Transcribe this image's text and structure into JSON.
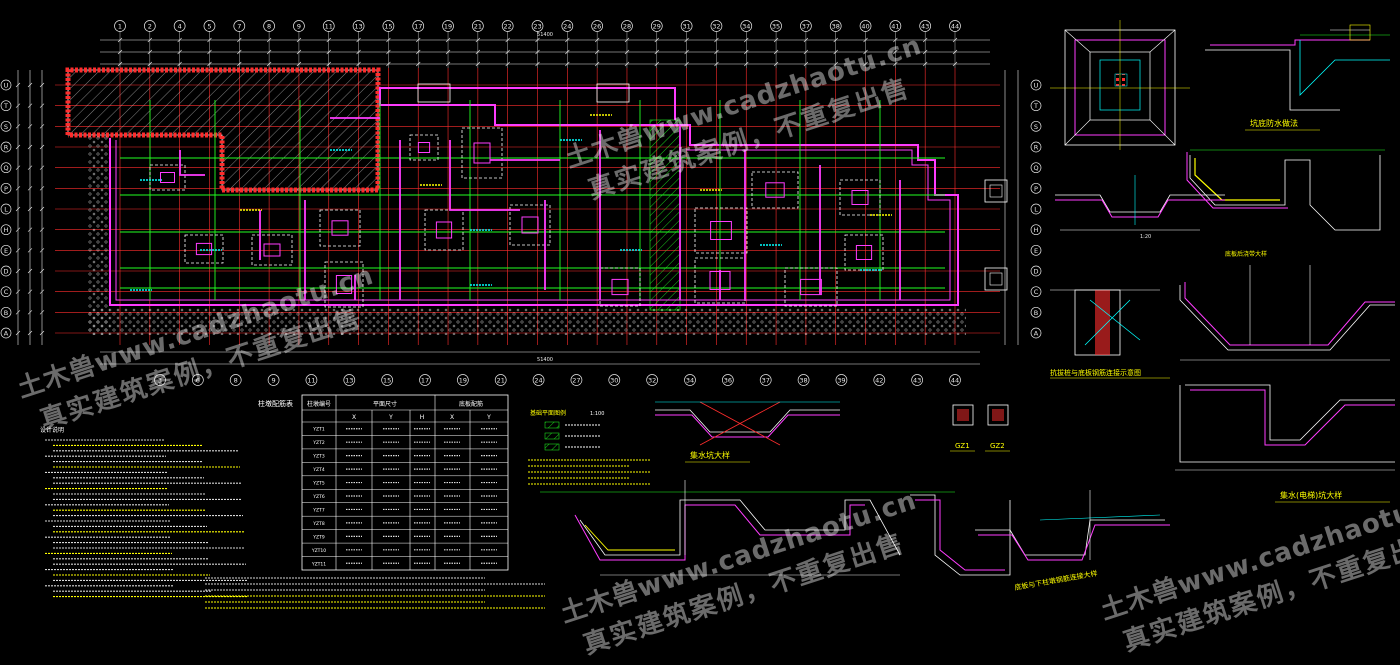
{
  "drawing": {
    "top_grid_labels": [
      "1",
      "2",
      "4",
      "5",
      "7",
      "8",
      "9",
      "11",
      "13",
      "15",
      "17",
      "19",
      "21",
      "22",
      "23",
      "24",
      "26",
      "28",
      "29",
      "31",
      "32",
      "34",
      "35",
      "37",
      "38",
      "40",
      "41",
      "43",
      "44"
    ],
    "bottom_grid_labels": [
      "3",
      "6",
      "8",
      "9",
      "11",
      "13",
      "15",
      "17",
      "19",
      "21",
      "24",
      "27",
      "30",
      "32",
      "34",
      "36",
      "37",
      "38",
      "39",
      "42",
      "43",
      "44"
    ],
    "left_grid_labels": [
      "U",
      "T",
      "S",
      "R",
      "Q",
      "P",
      "L",
      "H",
      "E",
      "D",
      "C",
      "B",
      "A"
    ],
    "right_grid_labels": [
      "U",
      "T",
      "S",
      "R",
      "Q",
      "P",
      "L",
      "H",
      "E",
      "D",
      "C",
      "B",
      "A"
    ],
    "overall_dimension": "51400",
    "legend_title": "基础平面图例",
    "legend_scale": "1:100",
    "table_title_left": "柱墩配筋表",
    "table_headers": [
      "柱墩编号",
      "平面尺寸",
      "底板配筋"
    ],
    "table_subheaders": [
      "X",
      "Y",
      "H",
      "X",
      "Y"
    ],
    "table_row_ids": [
      "YZT1",
      "YZT2",
      "YZT3",
      "YZT4",
      "YZT5",
      "YZT6",
      "YZT7",
      "YZT8",
      "YZT9",
      "YZT10",
      "YZT11"
    ],
    "notes_title": "设计说明",
    "section_title_1": "集水坑大样",
    "section_title_2": "底板后浇带大样",
    "section_title_3": "坑底防水做法",
    "section_title_4": "底板与下柱墩钢筋连接大样",
    "section_title_5": "集水(电梯)坑大样",
    "section_title_6": "抗拔桩与底板钢筋连接示意图",
    "detail_labels": [
      "GZ1",
      "GZ2"
    ],
    "watermark_line1": "土木兽www.cadzhaotu.cn",
    "watermark_line2": "真实建筑案例，不重复出售"
  },
  "colors": {
    "background": "#000000",
    "grid": "#ff2d2d",
    "wall": "#ff3cff",
    "beam": "#22ff22",
    "dimension": "#e8e8e8",
    "hatch": "#ffffff",
    "accent": "#ffff00",
    "cyan": "#00ffff"
  }
}
